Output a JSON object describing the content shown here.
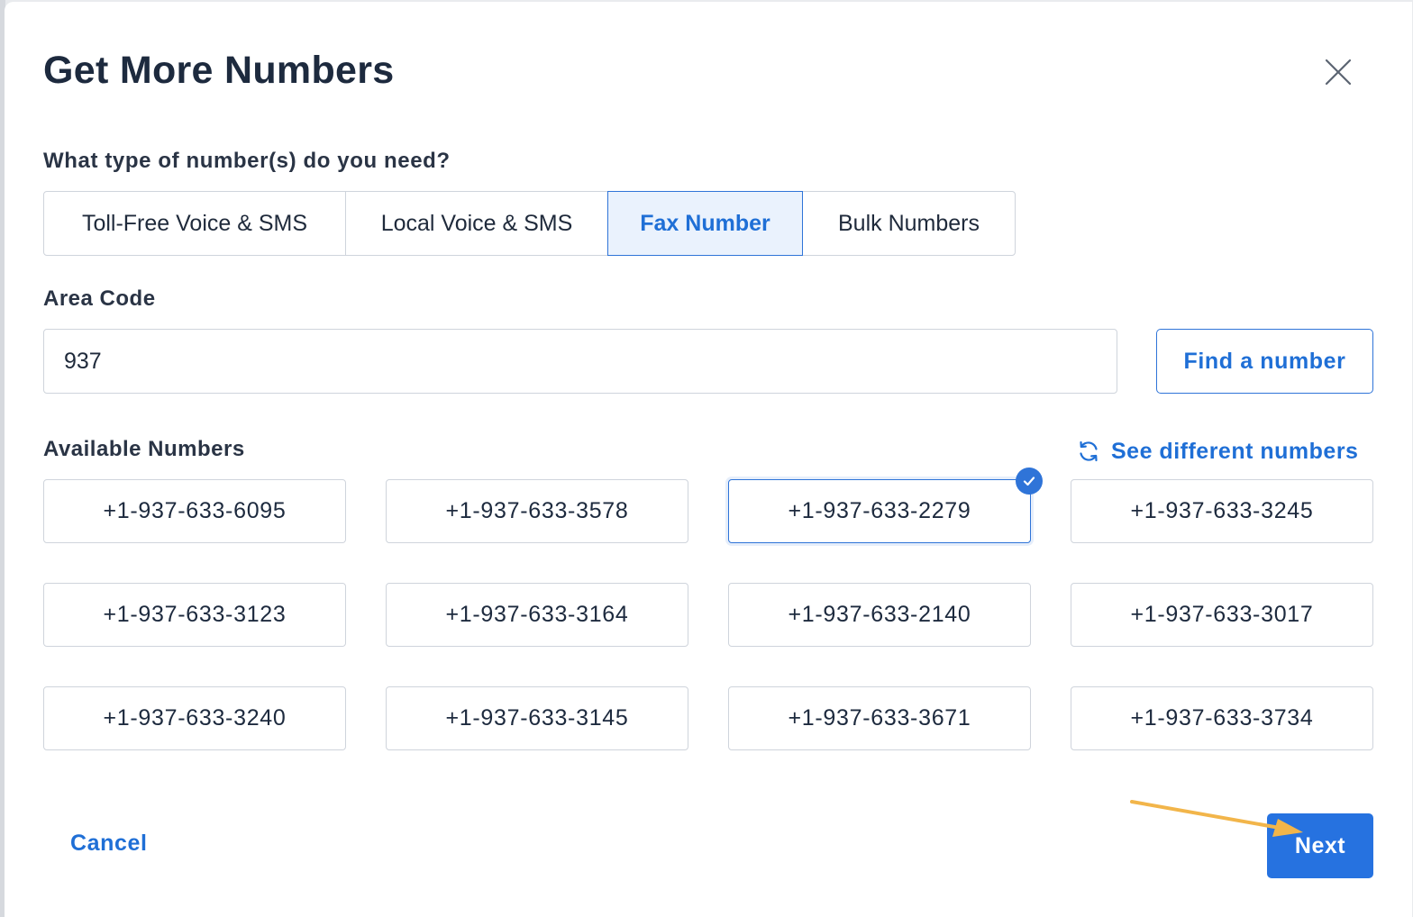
{
  "dialog": {
    "title": "Get More Numbers",
    "close_icon": "close-icon"
  },
  "number_type": {
    "question": "What type of number(s) do you need?",
    "options": [
      {
        "label": "Toll-Free Voice & SMS",
        "selected": false
      },
      {
        "label": "Local Voice & SMS",
        "selected": false
      },
      {
        "label": "Fax Number",
        "selected": true
      },
      {
        "label": "Bulk Numbers",
        "selected": false
      }
    ]
  },
  "area_code": {
    "label": "Area Code",
    "value": "937",
    "find_button": "Find a number"
  },
  "available": {
    "label": "Available Numbers",
    "refresh_label": "See different numbers",
    "refresh_icon": "refresh-icon",
    "numbers": [
      {
        "number": "+1-937-633-6095",
        "selected": false
      },
      {
        "number": "+1-937-633-3578",
        "selected": false
      },
      {
        "number": "+1-937-633-2279",
        "selected": true
      },
      {
        "number": "+1-937-633-3245",
        "selected": false
      },
      {
        "number": "+1-937-633-3123",
        "selected": false
      },
      {
        "number": "+1-937-633-3164",
        "selected": false
      },
      {
        "number": "+1-937-633-2140",
        "selected": false
      },
      {
        "number": "+1-937-633-3017",
        "selected": false
      },
      {
        "number": "+1-937-633-3240",
        "selected": false
      },
      {
        "number": "+1-937-633-3145",
        "selected": false
      },
      {
        "number": "+1-937-633-3671",
        "selected": false
      },
      {
        "number": "+1-937-633-3734",
        "selected": false
      }
    ]
  },
  "footer": {
    "cancel_label": "Cancel",
    "next_label": "Next"
  },
  "colors": {
    "accent": "#2672e0",
    "link": "#1f6fd6",
    "selected_bg": "#eaf2fd",
    "title": "#1d2a3e",
    "annotation_arrow": "#f2b54a"
  }
}
